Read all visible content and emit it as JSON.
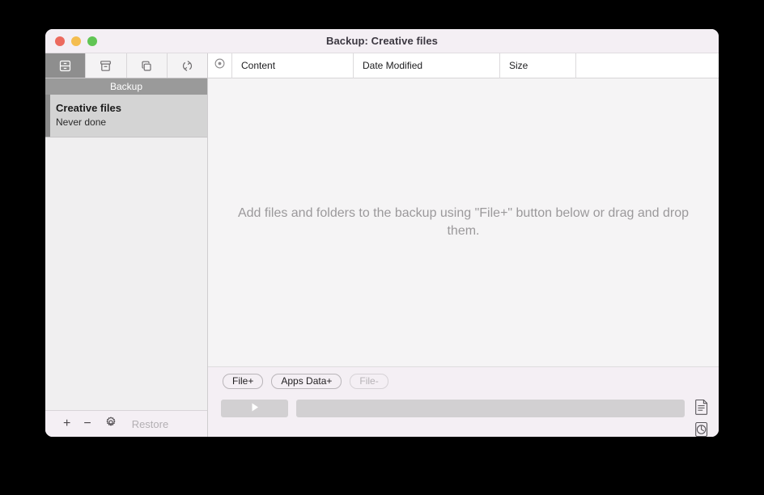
{
  "window": {
    "title": "Backup: Creative files",
    "traffic_lights": [
      {
        "name": "close",
        "color": "#ec6a5e"
      },
      {
        "name": "minimize",
        "color": "#f4bd4f"
      },
      {
        "name": "zoom",
        "color": "#61c554"
      }
    ]
  },
  "sidebar": {
    "tabs": [
      {
        "icon": "drawer-cabinet-icon",
        "selected": true
      },
      {
        "icon": "archive-box-icon",
        "selected": false
      },
      {
        "icon": "clone-squares-icon",
        "selected": false
      },
      {
        "icon": "sync-arrows-icon",
        "selected": false
      }
    ],
    "group_header": "Backup",
    "items": [
      {
        "title": "Creative files",
        "status": "Never done",
        "selected": true
      }
    ],
    "footer": {
      "add_label": "+",
      "remove_label": "−",
      "settings_icon": "gear-icon",
      "restore_label": "Restore"
    }
  },
  "content": {
    "columns": [
      {
        "key": "selector",
        "label": "",
        "icon": "target-circle-icon"
      },
      {
        "key": "content",
        "label": "Content"
      },
      {
        "key": "date_modified",
        "label": "Date Modified"
      },
      {
        "key": "size",
        "label": "Size"
      }
    ],
    "rows": [],
    "empty_message": "Add files and folders to the backup using \"File+\" button below or drag and drop them.",
    "action_buttons": [
      {
        "label": "File+",
        "enabled": true
      },
      {
        "label": "Apps Data+",
        "enabled": true
      },
      {
        "label": "File-",
        "enabled": false
      }
    ],
    "run_bar": {
      "play_icon": "play-triangle-icon",
      "status_value": "",
      "log_icon": "document-log-icon",
      "history_icon": "clock-history-icon"
    }
  },
  "colors": {
    "titlebar": "#f4eff4",
    "sidebar": "#f0eff0",
    "selection": "#d4d4d4",
    "accent_bar": "#8a8a8a",
    "group_header": "#9a9a9a",
    "content": "#f5f4f5"
  }
}
